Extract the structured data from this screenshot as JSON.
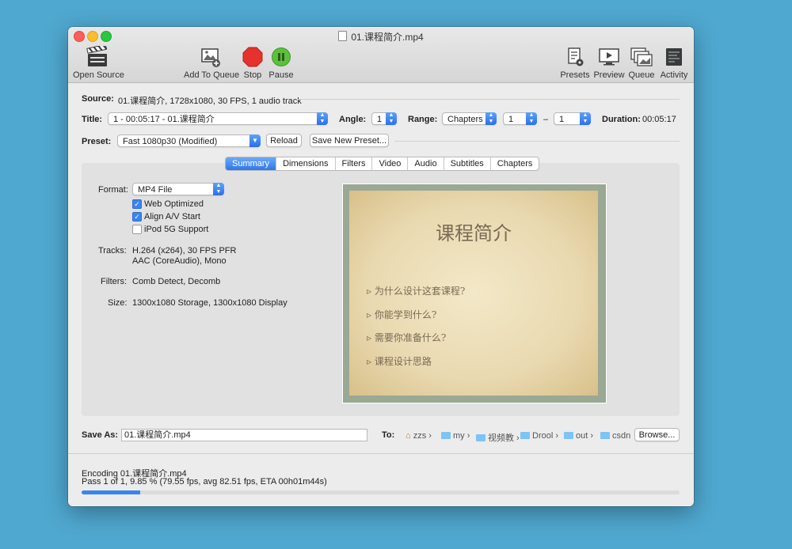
{
  "window": {
    "title": "01.课程简介.mp4"
  },
  "toolbar": {
    "open_source": "Open Source",
    "add_to_queue": "Add To Queue",
    "stop": "Stop",
    "pause": "Pause",
    "presets": "Presets",
    "preview": "Preview",
    "queue": "Queue",
    "activity": "Activity"
  },
  "source": {
    "label": "Source:",
    "value": "01.课程简介, 1728x1080, 30 FPS, 1 audio track"
  },
  "title_row": {
    "title_label": "Title:",
    "title_value": "1 - 00:05:17 - 01.课程简介",
    "angle_label": "Angle:",
    "angle_value": "1",
    "range_label": "Range:",
    "range_type": "Chapters",
    "range_start": "1",
    "range_dash": "–",
    "range_end": "1",
    "duration_label": "Duration:",
    "duration_value": "00:05:17"
  },
  "preset": {
    "label": "Preset:",
    "value": "Fast 1080p30 (Modified)",
    "reload": "Reload",
    "save_new": "Save New Preset..."
  },
  "tabs": [
    "Summary",
    "Dimensions",
    "Filters",
    "Video",
    "Audio",
    "Subtitles",
    "Chapters"
  ],
  "summary": {
    "format_label": "Format:",
    "format_value": "MP4 File",
    "web_optimized": "Web Optimized",
    "align_av": "Align A/V Start",
    "ipod": "iPod 5G Support",
    "checks": {
      "web_optimized": true,
      "align_av": true,
      "ipod": false
    },
    "tracks_label": "Tracks:",
    "tracks_line1": "H.264 (x264), 30 FPS PFR",
    "tracks_line2": "AAC (CoreAudio), Mono",
    "filters_label": "Filters:",
    "filters_value": "Comb Detect, Decomb",
    "size_label": "Size:",
    "size_value": "1300x1080 Storage, 1300x1080 Display"
  },
  "preview_slide": {
    "title": "课程简介",
    "bullets": [
      "为什么设计这套课程?",
      "你能学到什么?",
      "需要你准备什么?",
      "课程设计思路"
    ]
  },
  "save": {
    "label": "Save As:",
    "value": "01.课程简介.mp4",
    "to_label": "To:",
    "path": [
      "zzs",
      "my",
      "视频教",
      "Drool",
      "out",
      "csdn"
    ],
    "browse": "Browse..."
  },
  "status": {
    "line1": "Encoding 01.课程简介.mp4",
    "line2": "Pass 1 of 1, 9.85 % (79.55 fps, avg 82.51 fps, ETA 00h01m44s)",
    "progress_percent": 9.85
  },
  "colors": {
    "accent": "#3a84f0",
    "stop": "#e5322d",
    "pause": "#5cc03c"
  }
}
